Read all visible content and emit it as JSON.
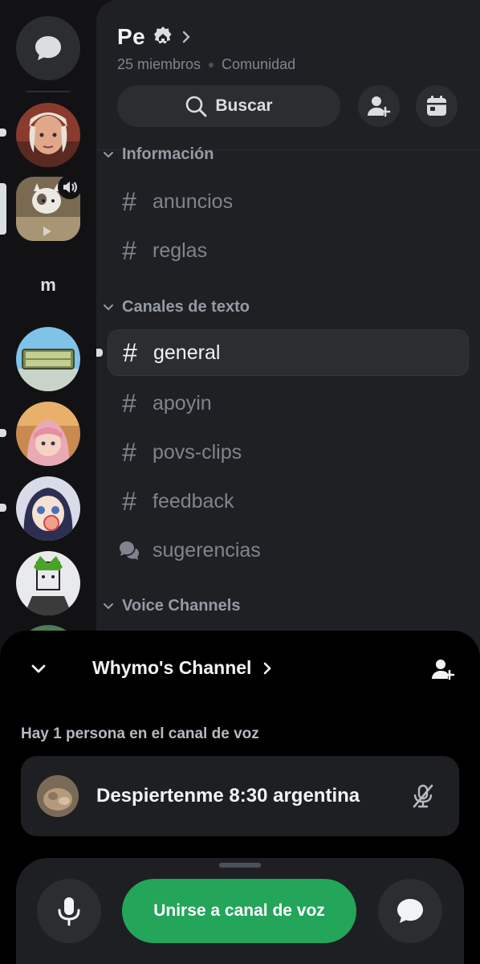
{
  "server": {
    "name": "Pe",
    "members": "25 miembros",
    "type": "Comunidad"
  },
  "search": {
    "label": "Buscar"
  },
  "servers": {
    "letter_server": "m"
  },
  "categories": [
    {
      "label": "Información"
    },
    {
      "label": "Canales de texto"
    },
    {
      "label": "Voice Channels"
    }
  ],
  "channels": [
    {
      "label": "anuncios",
      "icon": "hash-icon"
    },
    {
      "label": "reglas",
      "icon": "hash-icon"
    },
    {
      "label": "general",
      "icon": "hash-icon",
      "active": true
    },
    {
      "label": "apoyin",
      "icon": "hash-icon"
    },
    {
      "label": "povs-clips",
      "icon": "hash-icon"
    },
    {
      "label": "feedback",
      "icon": "hash-icon"
    },
    {
      "label": "sugerencias",
      "icon": "forum-icon"
    }
  ],
  "voice_sheet": {
    "channel_title": "Whymo's Channel",
    "count_text": "Hay 1 persona en el canal de voz",
    "user": {
      "name": "Despiertenme 8:30 argentina",
      "muted": true
    },
    "join_label": "Unirse a canal de voz"
  },
  "colors": {
    "join_green": "#23a55a",
    "panel_bg": "#1f2024",
    "rail_bg": "#121214"
  }
}
